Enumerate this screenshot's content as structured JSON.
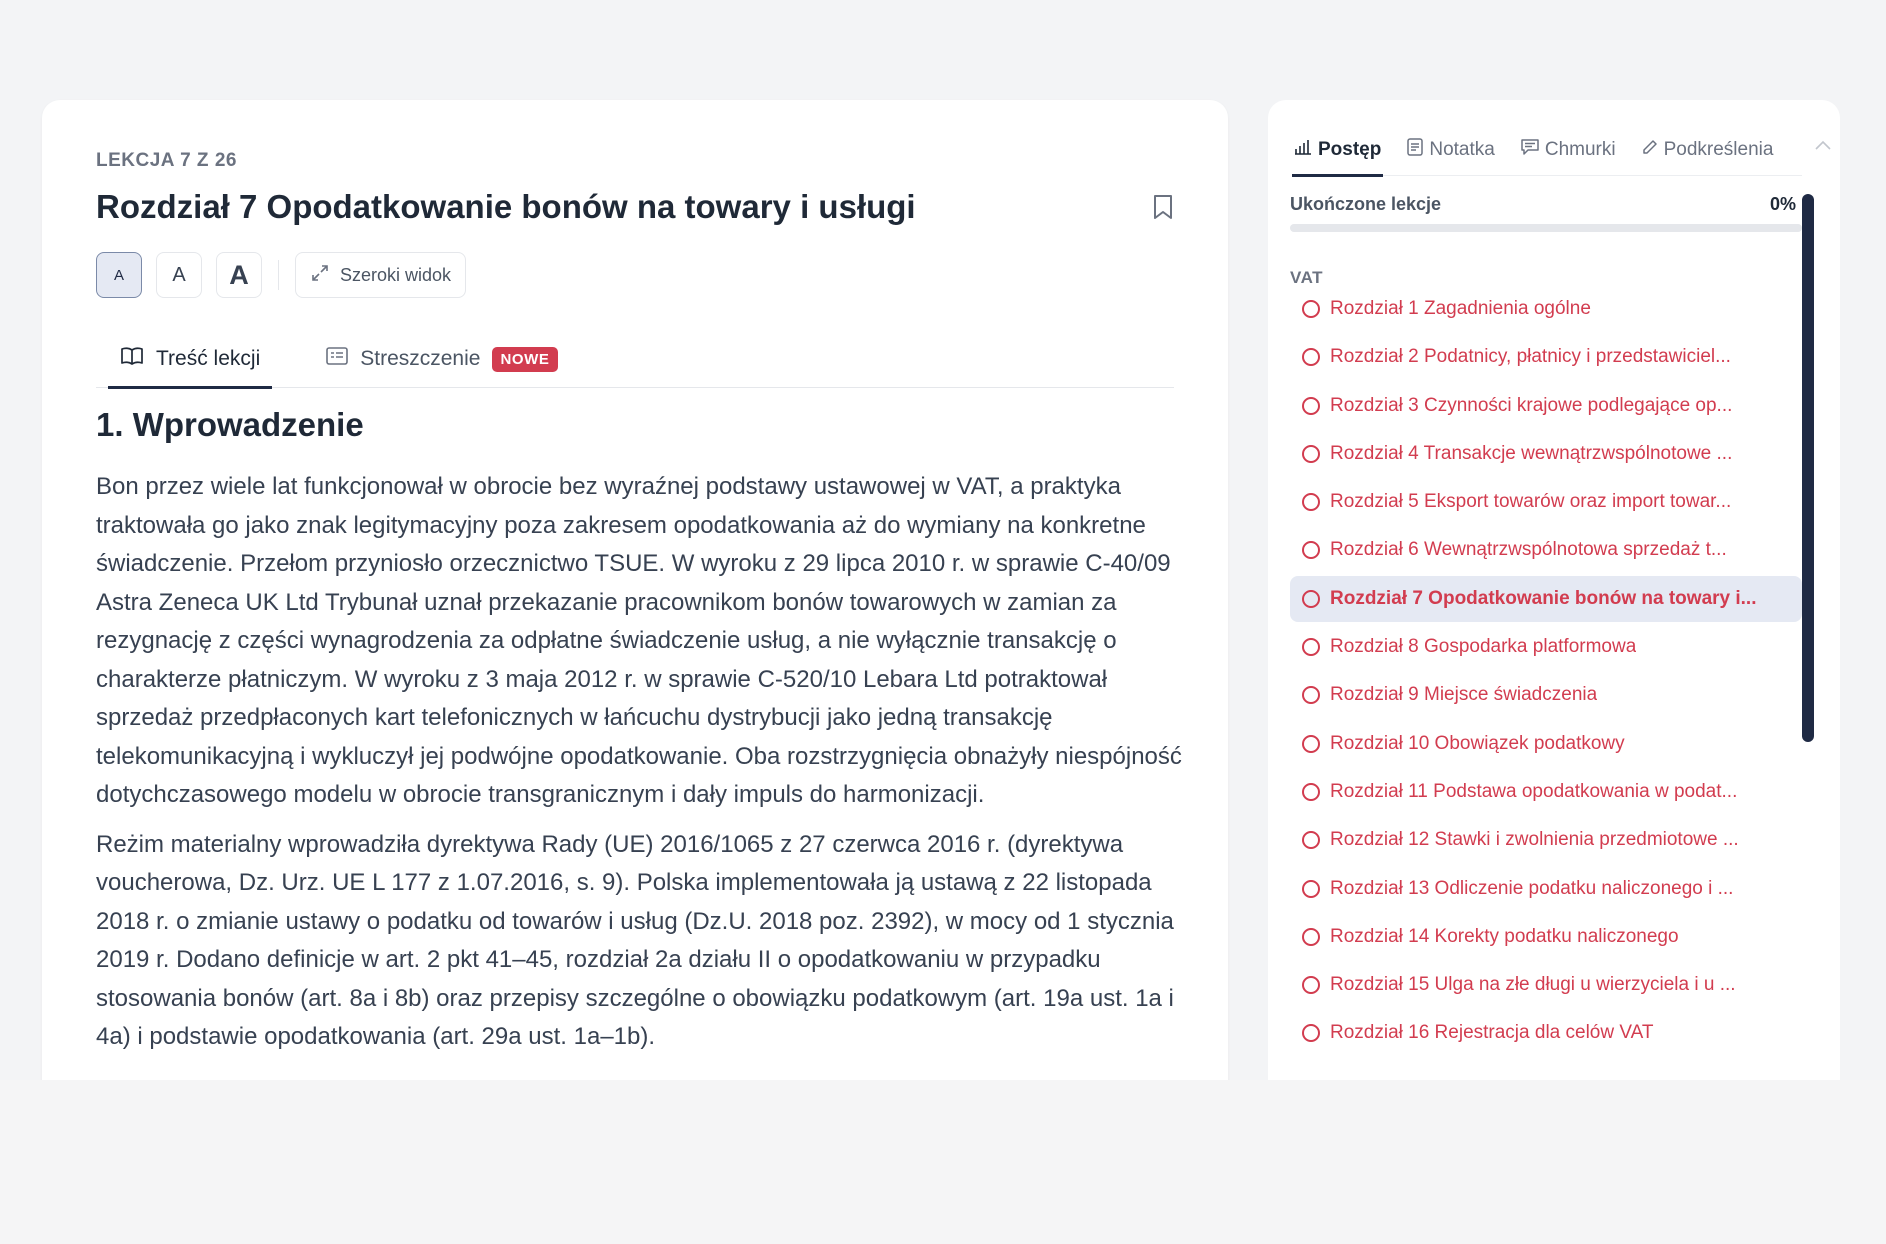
{
  "lesson": {
    "counter": "LEKCJA 7 Z 26",
    "title": "Rozdział 7 Opodatkowanie bonów na towary i usługi"
  },
  "toolbar": {
    "font_small": "A",
    "font_medium": "A",
    "font_large": "A",
    "wide_view": "Szeroki widok"
  },
  "tabs": {
    "content": "Treść lekcji",
    "summary": "Streszczenie",
    "summary_badge": "NOWE"
  },
  "article": {
    "heading": "1. Wprowadzenie",
    "paragraphs": [
      "Bon przez wiele lat funkcjonował w obrocie bez wyraźnej podstawy ustawowej w VAT, a praktyka traktowała go jako znak legitymacyjny poza zakresem opodatkowania aż do wymiany na konkretne świadczenie. Przełom przyniosło orzecznictwo TSUE. W wyroku z 29 lipca 2010 r. w sprawie C-40/09 Astra Zeneca UK Ltd Trybunał uznał przekazanie pracownikom bonów towarowych w zamian za rezygnację z części wynagrodzenia za odpłatne świadczenie usług, a nie wyłącznie transakcję o charakterze płatniczym. W wyroku z 3 maja 2012 r. w sprawie C-520/10 Lebara Ltd potraktował sprzedaż przedpłaconych kart telefonicznych w łańcuchu dystrybucji jako jedną transakcję telekomunikacyjną i wykluczył jej podwójne opodatkowanie. Oba rozstrzygnięcia obnażyły niespójność dotychczasowego modelu w obrocie transgranicznym i dały impuls do harmonizacji.",
      "Reżim materialny wprowadziła dyrektywa Rady (UE) 2016/1065 z 27 czerwca 2016 r. (dyrektywa voucherowa, Dz. Urz. UE L 177 z 1.07.2016, s. 9). Polska implementowała ją ustawą z 22 listopada 2018 r. o zmianie ustawy o podatku od towarów i usług (Dz.U. 2018 poz. 2392), w mocy od 1 stycznia 2019 r. Dodano definicje w art. 2 pkt 41–45, rozdział 2a działu II o opodatkowaniu w przypadku stosowania bonów (art. 8a i 8b) oraz przepisy szczególne o obowiązku podatkowym (art. 19a ust. 1a i 4a) i podstawie opodatkowania (art. 29a ust. 1a–1b)."
    ]
  },
  "side": {
    "tabs": {
      "progress": "Postęp",
      "note": "Notatka",
      "clouds": "Chmurki",
      "highlights": "Podkreślenia"
    },
    "progress_label": "Ukończone lekcje",
    "progress_value": "0%",
    "progress_fraction": 0,
    "group_label": "VAT",
    "chapters": [
      "Rozdział 1 Zagadnienia ogólne",
      "Rozdział 2 Podatnicy, płatnicy i przedstawiciel...",
      "Rozdział 3 Czynności krajowe podlegające op...",
      "Rozdział 4 Transakcje wewnątrzwspólnotowe ...",
      "Rozdział 5 Eksport towarów oraz import towar...",
      "Rozdział 6 Wewnątrzwspólnotowa sprzedaż t...",
      "Rozdział 7 Opodatkowanie bonów na towary i...",
      "Rozdział 8 Gospodarka platformowa",
      "Rozdział 9 Miejsce świadczenia",
      "Rozdział 10 Obowiązek podatkowy",
      "Rozdział 11 Podstawa opodatkowania w podat...",
      "Rozdział 12 Stawki i zwolnienia przedmiotowe ...",
      "Rozdział 13 Odliczenie podatku naliczonego i ...",
      "Rozdział 14 Korekty podatku naliczonego",
      "Rozdział 15 Ulga na złe długi u wierzyciela i u ...",
      "Rozdział 16 Rejestracja dla celów VAT"
    ],
    "active_chapter_index": 6
  },
  "colors": {
    "accent": "#1f2a44",
    "chapter_text": "#d23c4f",
    "badge": "#d23c4f",
    "active_bg": "#e5e9f3"
  }
}
